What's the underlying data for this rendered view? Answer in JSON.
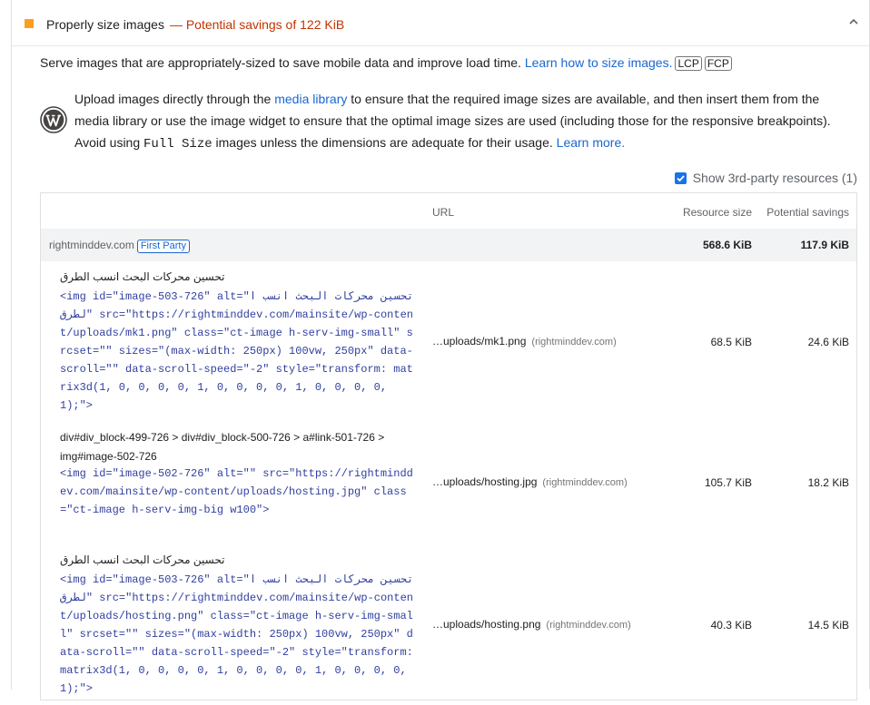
{
  "audit": {
    "title": "Properly size images",
    "savings": "— Potential savings of 122 KiB",
    "status_color": "#fa9f1e"
  },
  "description": {
    "text": "Serve images that are appropriately-sized to save mobile data and improve load time. ",
    "link": "Learn how to size images.",
    "tags": [
      "LCP",
      "FCP"
    ]
  },
  "stack_pack": {
    "icon": "wordpress-icon",
    "pre": "Upload images directly through the ",
    "media_link": "media library",
    "mid": " to ensure that the required image sizes are available, and then insert them from the media library or use the image widget to ensure that the optimal image sizes are used (including those for the responsive breakpoints). Avoid using ",
    "code": "Full Size",
    "post": " images unless the dimensions are adequate for their usage. ",
    "learn_more": "Learn more."
  },
  "third_party": {
    "checked": true,
    "label": "Show 3rd-party resources (1)"
  },
  "table": {
    "headers": {
      "url": "URL",
      "size": "Resource size",
      "savings": "Potential savings"
    },
    "group": {
      "origin": "rightminddev.com",
      "badge": "First Party",
      "size": "568.6 KiB",
      "savings": "117.9 KiB"
    },
    "rows": [
      {
        "label": "تحسين محركات البحث انسب الطرق",
        "snippet": "<img id=\"image-503-726\" alt=\"تحسين محركات البحث انسب الطرق\" src=\"https://rightminddev.com/mainsite/wp-content/uploads/mk1.png\" class=\"ct-image h-serv-img-small\" srcset=\"\" sizes=\"(max-width: 250px) 100vw, 250px\" data-scroll=\"\" data-scroll-speed=\"-2\" style=\"transform: matrix3d(1, 0, 0, 0, 0, 1, 0, 0, 0, 0, 1, 0, 0, 0, 0, 1);\">",
        "url": "…uploads/mk1.png",
        "host": "(rightminddev.com)",
        "size": "68.5 KiB",
        "savings": "24.6 KiB"
      },
      {
        "label": "div#div_block-499-726 > div#div_block-500-726 > a#link-501-726 > img#image-502-726",
        "snippet": "<img id=\"image-502-726\" alt=\"\" src=\"https://rightminddev.com/mainsite/wp-content/uploads/hosting.jpg\" class=\"ct-image h-serv-img-big w100\">",
        "url": "…uploads/hosting.jpg",
        "host": "(rightminddev.com)",
        "size": "105.7 KiB",
        "savings": "18.2 KiB"
      },
      {
        "label": "تحسين محركات البحث انسب الطرق",
        "snippet": "<img id=\"image-503-726\" alt=\"تحسين محركات البحث انسب الطرق\" src=\"https://rightminddev.com/mainsite/wp-content/uploads/hosting.png\" class=\"ct-image h-serv-img-small\" srcset=\"\" sizes=\"(max-width: 250px) 100vw, 250px\" data-scroll=\"\" data-scroll-speed=\"-2\" style=\"transform: matrix3d(1, 0, 0, 0, 0, 1, 0, 0, 0, 0, 1, 0, 0, 0, 0, 1);\">",
        "url": "…uploads/hosting.png",
        "host": "(rightminddev.com)",
        "size": "40.3 KiB",
        "savings": "14.5 KiB"
      }
    ]
  }
}
